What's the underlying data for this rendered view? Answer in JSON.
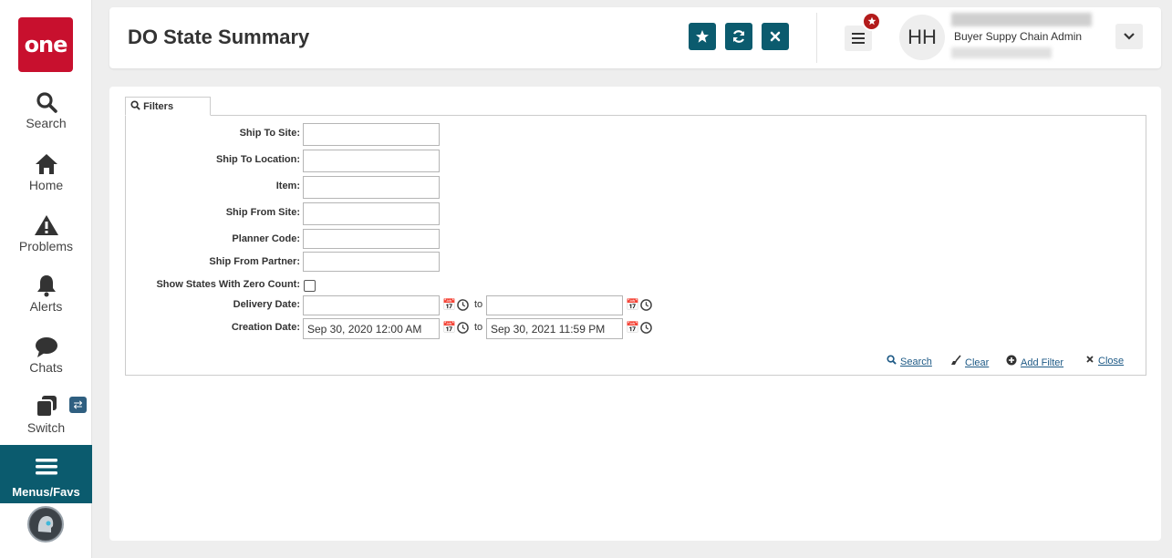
{
  "sidebar": {
    "logo": "one",
    "items": [
      {
        "label": "Search",
        "icon": "search-icon"
      },
      {
        "label": "Home",
        "icon": "home-icon"
      },
      {
        "label": "Problems",
        "icon": "warning-icon"
      },
      {
        "label": "Alerts",
        "icon": "bell-icon"
      },
      {
        "label": "Chats",
        "icon": "chat-icon"
      },
      {
        "label": "Switch",
        "icon": "switch-icon"
      }
    ],
    "switch_badge": "⇄",
    "menus_label": "Menus/Favs"
  },
  "header": {
    "title": "DO State Summary",
    "initials": "HH",
    "user_role": "Buyer Suppy Chain Admin",
    "accent_color": "#0b5b6e"
  },
  "filters": {
    "tab_label": "Filters",
    "fields": {
      "ship_to_site": {
        "label": "Ship To Site:",
        "value": ""
      },
      "ship_to_location": {
        "label": "Ship To Location:",
        "value": ""
      },
      "item": {
        "label": "Item:",
        "value": ""
      },
      "ship_from_site": {
        "label": "Ship From Site:",
        "value": ""
      },
      "planner_code": {
        "label": "Planner Code:",
        "value": ""
      },
      "ship_from_partner": {
        "label": "Ship From Partner:",
        "value": ""
      }
    },
    "zero_count_label": "Show States With Zero Count:",
    "delivery_date": {
      "label": "Delivery Date:",
      "from": "",
      "to": ""
    },
    "creation_date": {
      "label": "Creation Date:",
      "from": "Sep 30, 2020 12:00 AM",
      "to": "Sep 30, 2021 11:59 PM"
    },
    "to_label": "to",
    "actions": {
      "search": "Search",
      "clear": "Clear",
      "add_filter": "Add Filter",
      "close": "Close"
    }
  }
}
